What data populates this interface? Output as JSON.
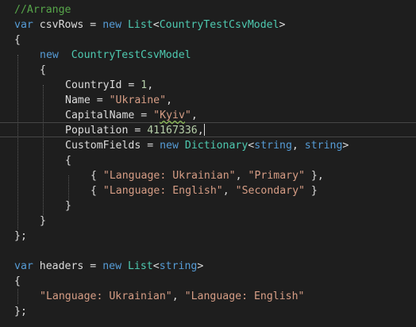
{
  "editor": {
    "comment": "//Arrange",
    "kw_var": "var",
    "kw_new": "new",
    "id_csvRows": "csvRows",
    "type_List": "List",
    "type_Model": "CountryTestCsvModel",
    "type_Dictionary": "Dictionary",
    "kw_string": "string",
    "id_headers": "headers",
    "prop_CountryId": "CountryId",
    "prop_Name": "Name",
    "prop_CapitalName": "CapitalName",
    "prop_Population": "Population",
    "prop_CustomFields": "CustomFields",
    "num_1": "1",
    "num_population": "41167336",
    "str_ukraine": "\"Ukraine\"",
    "str_kyiv_open": "\"",
    "str_kyiv_word": "Kyiv",
    "str_kyiv_close": "\"",
    "str_lang_ukr": "\"Language: Ukrainian\"",
    "str_primary": "\"Primary\"",
    "str_lang_eng": "\"Language: English\"",
    "str_secondary": "\"Secondary\""
  },
  "colors": {
    "background": "#1e1e1e",
    "keyword": "#569cd6",
    "type": "#4ec9b0",
    "string": "#d69d85",
    "number": "#b5cea8",
    "comment": "#57a64a",
    "text": "#dcdcdc"
  }
}
